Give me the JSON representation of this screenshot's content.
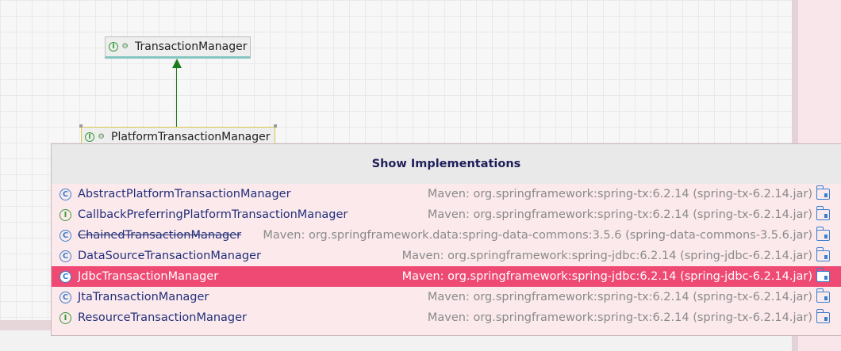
{
  "diagram": {
    "nodes": [
      {
        "id": "transaction-manager",
        "label": "TransactionManager",
        "badge": "I"
      },
      {
        "id": "platform-transaction-manager",
        "label": "PlatformTransactionManager",
        "badge": "I"
      }
    ],
    "edge": {
      "from": "platform-transaction-manager",
      "to": "transaction-manager",
      "kind": "extends"
    }
  },
  "popup": {
    "title": "Show Implementations",
    "selected_index": 4,
    "items": [
      {
        "kind": "C",
        "name": "AbstractPlatformTransactionManager",
        "location": "Maven: org.springframework:spring-tx:6.2.14 (spring-tx-6.2.14.jar)",
        "deprecated": false
      },
      {
        "kind": "I",
        "name": "CallbackPreferringPlatformTransactionManager",
        "location": "Maven: org.springframework:spring-tx:6.2.14 (spring-tx-6.2.14.jar)",
        "deprecated": false
      },
      {
        "kind": "C",
        "name": "ChainedTransactionManager",
        "location": "Maven: org.springframework.data:spring-data-commons:3.5.6 (spring-data-commons-3.5.6.jar)",
        "deprecated": true
      },
      {
        "kind": "C",
        "name": "DataSourceTransactionManager",
        "location": "Maven: org.springframework:spring-jdbc:6.2.14 (spring-jdbc-6.2.14.jar)",
        "deprecated": false
      },
      {
        "kind": "C",
        "name": "JdbcTransactionManager",
        "location": "Maven: org.springframework:spring-jdbc:6.2.14 (spring-jdbc-6.2.14.jar)",
        "deprecated": false
      },
      {
        "kind": "C",
        "name": "JtaTransactionManager",
        "location": "Maven: org.springframework:spring-tx:6.2.14 (spring-tx-6.2.14.jar)",
        "deprecated": false
      },
      {
        "kind": "I",
        "name": "ResourceTransactionManager",
        "location": "Maven: org.springframework:spring-tx:6.2.14 (spring-tx-6.2.14.jar)",
        "deprecated": false
      }
    ]
  },
  "colors": {
    "selection": "#ef4a73",
    "interface_badge": "#3a9a3a",
    "class_badge": "#3a7fd0",
    "inheritance_arrow": "#1b7c1b"
  }
}
